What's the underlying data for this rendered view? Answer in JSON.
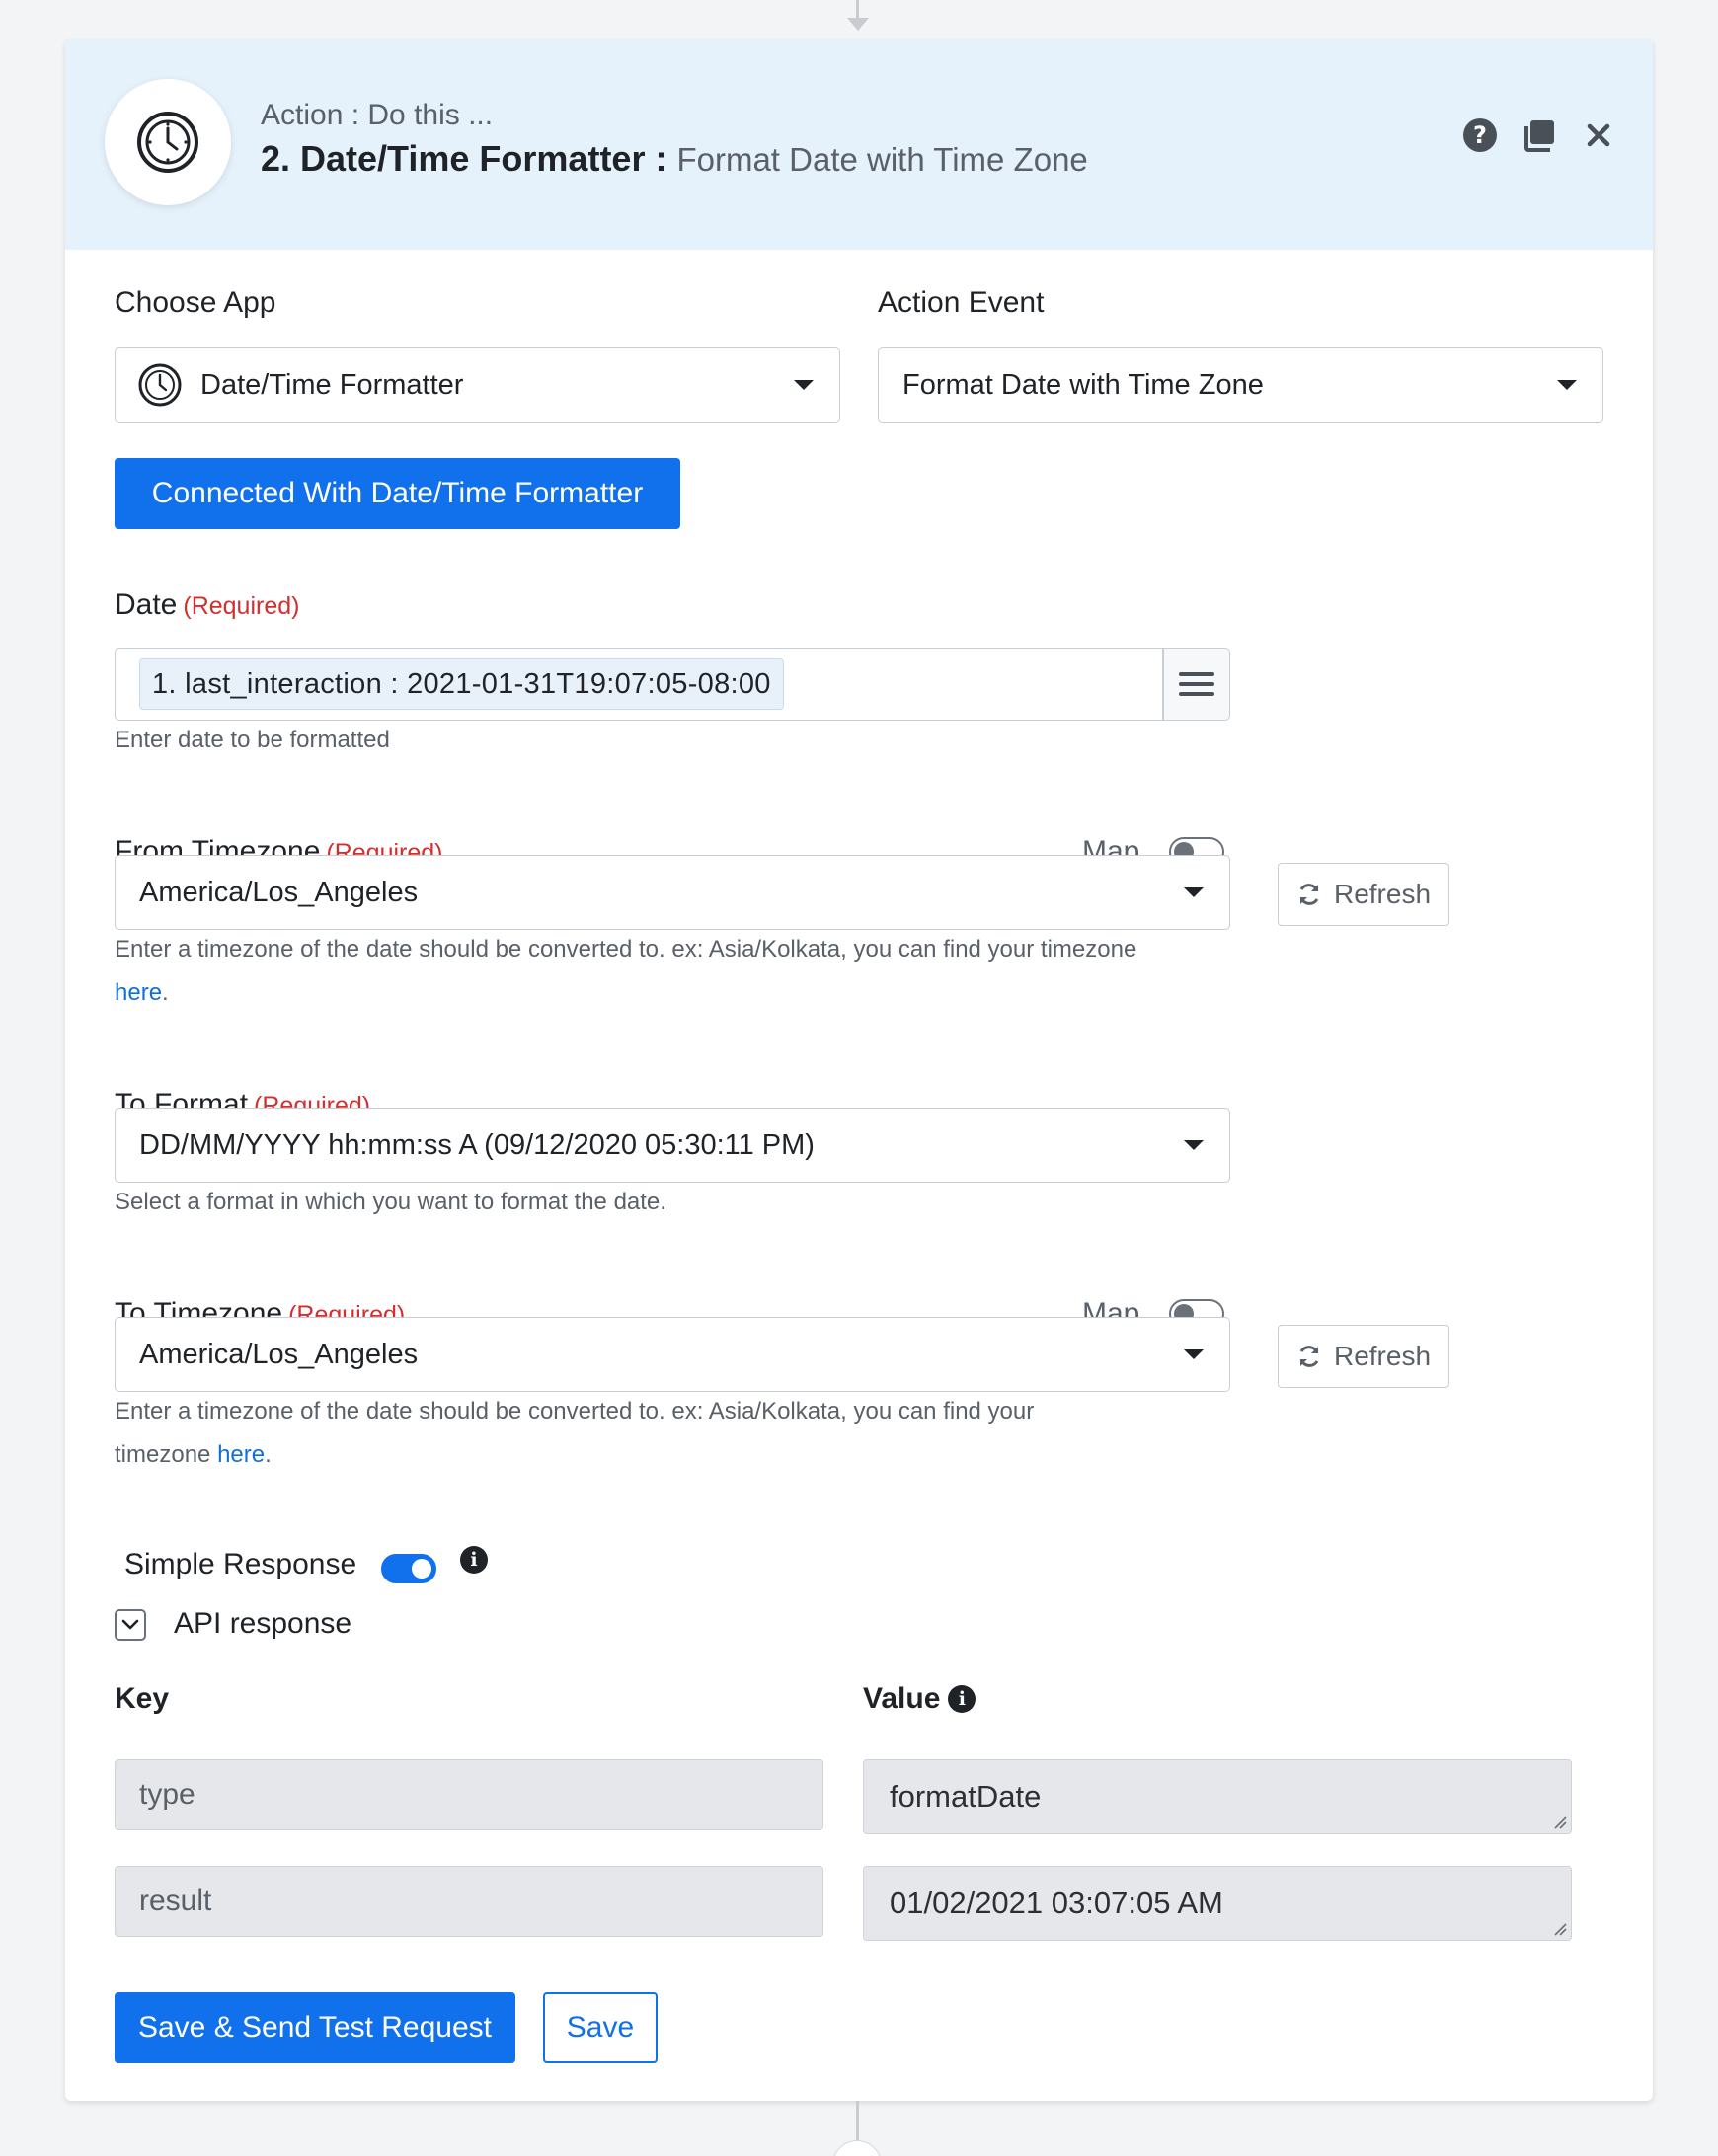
{
  "header": {
    "kicker": "Action : Do this ...",
    "title_main": "2. Date/Time Formatter :",
    "title_sub": "Format Date with Time Zone",
    "icons": [
      "question-icon",
      "copy-icon",
      "close-icon"
    ]
  },
  "choose_app": {
    "label": "Choose App",
    "value": "Date/Time Formatter",
    "icon": "clock-icon"
  },
  "action_event": {
    "label": "Action Event",
    "value": "Format Date with Time Zone"
  },
  "connected_button": "Connected With Date/Time Formatter",
  "required_text": "(Required)",
  "date": {
    "label": "Date",
    "token": "1. last_interaction : 2021-01-31T19:07:05-08:00",
    "help": "Enter date to be formatted"
  },
  "from_timezone": {
    "label": "From Timezone",
    "map_label": "Map",
    "map_on": false,
    "value": "America/Los_Angeles",
    "help_line1": "Enter a timezone of the date should be converted to. ex: Asia/Kolkata, you can find your timezone",
    "help_link": "here",
    "help_end": ".",
    "refresh_label": "Refresh"
  },
  "to_format": {
    "label": "To Format",
    "value": "DD/MM/YYYY hh:mm:ss A (09/12/2020 05:30:11 PM)",
    "help": "Select a format in which you want to format the date."
  },
  "to_timezone": {
    "label": "To Timezone",
    "map_label": "Map",
    "map_on": false,
    "value": "America/Los_Angeles",
    "help_line1": "Enter a timezone of the date should be converted to. ex: Asia/Kolkata, you can find your",
    "help_line2_prefix": "timezone ",
    "help_link": "here",
    "help_end": ".",
    "refresh_label": "Refresh"
  },
  "simple_response": {
    "label": "Simple Response",
    "on": true
  },
  "api_response": {
    "label": "API response"
  },
  "kv_table": {
    "key_header": "Key",
    "value_header": "Value",
    "rows": [
      {
        "key": "type",
        "value": "formatDate"
      },
      {
        "key": "result",
        "value": "01/02/2021 03:07:05 AM"
      }
    ]
  },
  "footer": {
    "save_test_label": "Save & Send Test Request",
    "save_label": "Save"
  },
  "colors": {
    "accent": "#1170eb",
    "header_bg": "#e5f1fb",
    "required": "#d32f2f",
    "link": "#1170d8"
  }
}
